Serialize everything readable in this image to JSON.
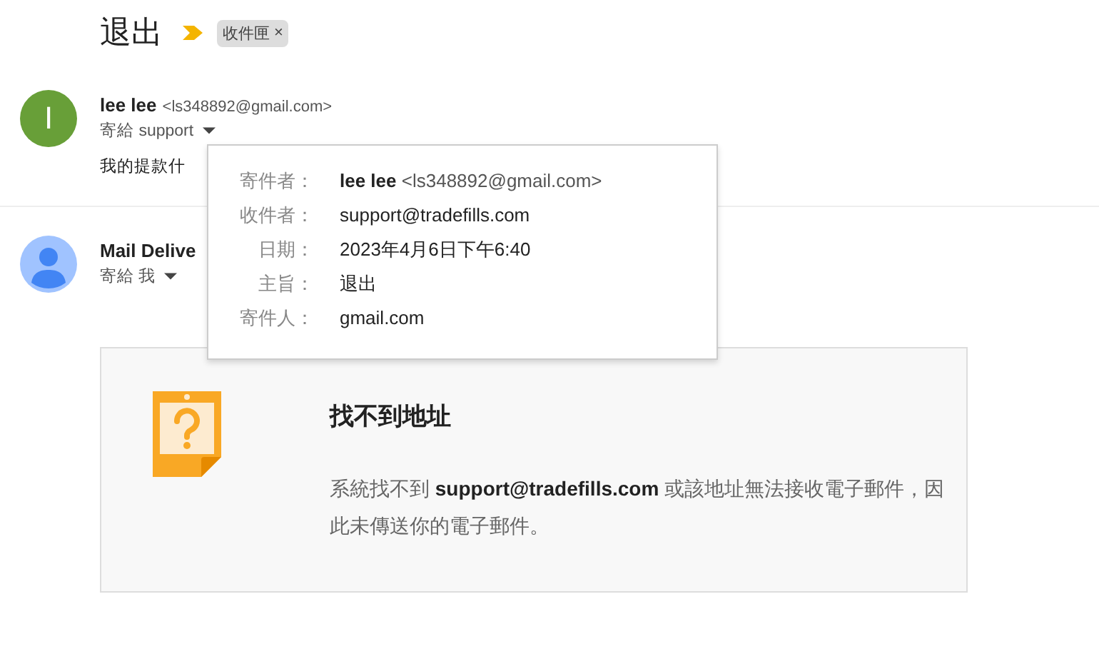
{
  "subject": "退出",
  "label_chip": {
    "text": "收件匣",
    "close": "×"
  },
  "messages": [
    {
      "avatar": {
        "kind": "letter",
        "letter": "I"
      },
      "sender_name": "lee lee",
      "sender_email": "<ls348892@gmail.com>",
      "to_line": "寄給 support",
      "snippet": "我的提款什"
    },
    {
      "avatar": {
        "kind": "person"
      },
      "sender_name": "Mail Delive",
      "to_line": "寄給 我"
    }
  ],
  "details_popup": [
    {
      "label": "寄件者：",
      "name": "lee lee",
      "value": "<ls348892@gmail.com>"
    },
    {
      "label": "收件者：",
      "value": "support@tradefills.com"
    },
    {
      "label": "日期：",
      "value": "2023年4月6日下午6:40"
    },
    {
      "label": "主旨：",
      "value": "退出"
    },
    {
      "label": "寄件人：",
      "value": "gmail.com"
    }
  ],
  "bounce_card": {
    "title": "找不到地址",
    "body": "系統找不到 **support@tradefills.com** 或該地址無法接收電子郵件，因此未傳送你的電子郵件。"
  }
}
